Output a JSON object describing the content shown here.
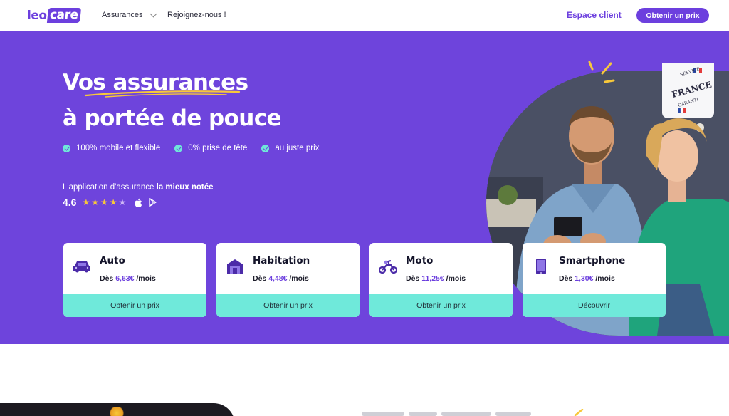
{
  "nav": {
    "logo_left": "leo",
    "logo_right": "care",
    "assurances": "Assurances",
    "rejoignez": "Rejoignez-nous !",
    "espace_client": "Espace client",
    "obtenir_prix": "Obtenir un prix"
  },
  "hero": {
    "title_line1": "Vos assurances",
    "title_line2": "à portée de pouce",
    "bullets": [
      "100% mobile et flexible",
      "0% prise de tête",
      "au juste prix"
    ],
    "tagline_prefix": "L'application d'assurance ",
    "tagline_bold": "la mieux notée",
    "rating": "4.6",
    "rating_value": 4.6,
    "rating_max": 5,
    "badge_text": "FRANCE",
    "badge_arc_top": "SERVICE",
    "badge_arc_bottom": "GARANTI"
  },
  "cards": [
    {
      "title": "Auto",
      "price_prefix": "Dès ",
      "price_value": "6,63€",
      "price_suffix": " /mois",
      "cta": "Obtenir un prix",
      "icon": "car-icon"
    },
    {
      "title": "Habitation",
      "price_prefix": "Dès ",
      "price_value": "4,48€",
      "price_suffix": " /mois",
      "cta": "Obtenir un prix",
      "icon": "house-icon"
    },
    {
      "title": "Moto",
      "price_prefix": "Dès ",
      "price_value": "11,25€",
      "price_suffix": " /mois",
      "cta": "Obtenir un prix",
      "icon": "scooter-icon"
    },
    {
      "title": "Smartphone",
      "price_prefix": "Dès ",
      "price_value": "1,30€",
      "price_suffix": " /mois",
      "cta": "Découvrir",
      "icon": "smartphone-icon"
    }
  ],
  "colors": {
    "brand_purple": "#6e44dc",
    "accent_mint": "#6fe9da",
    "star_yellow": "#f8c83a"
  }
}
